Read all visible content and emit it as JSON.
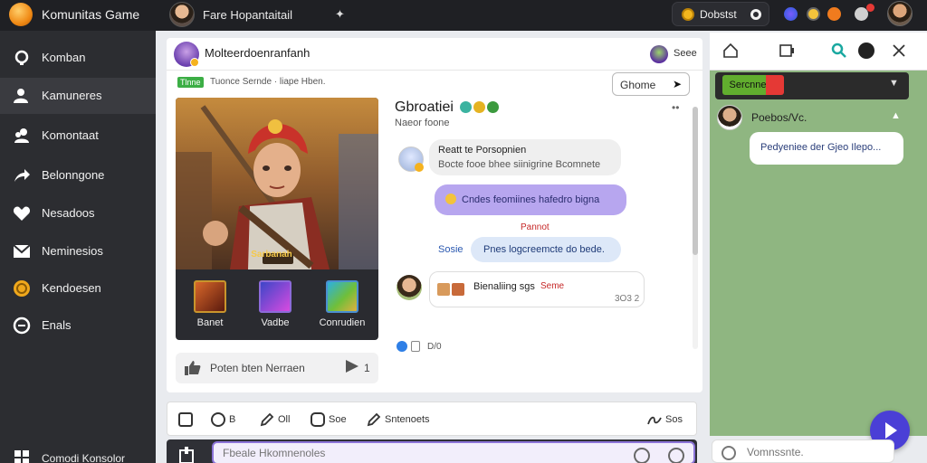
{
  "app": {
    "title": "Komunitas Game"
  },
  "topbar": {
    "page_name": "Fare Hopantaitail",
    "action_icon": "pin-icon",
    "status_label": "Dobstst",
    "icons": [
      "globe-icon",
      "emoji-icon",
      "fire-icon",
      "bell-icon"
    ]
  },
  "sidebar": {
    "items": [
      {
        "label": "Komban",
        "icon": "search-icon"
      },
      {
        "label": "Kamuneres",
        "icon": "user-icon"
      },
      {
        "label": "Komontaat",
        "icon": "users-icon"
      },
      {
        "label": "Belonngone",
        "icon": "share-icon"
      },
      {
        "label": "Nesadoos",
        "icon": "heart-icon"
      },
      {
        "label": "Neminesios",
        "icon": "mail-icon"
      },
      {
        "label": "Kendoesen",
        "icon": "coin-icon"
      },
      {
        "label": "Enals",
        "icon": "plus-circle-icon"
      }
    ],
    "bottom_label": "Comodi Konsolor"
  },
  "post": {
    "title": "Molteerdoenranfanh",
    "header_right": "Seee",
    "tag": "Tlnne",
    "tag_text": "Tuonce Sernde · liape Hben.",
    "share_label": "Ghome",
    "art_label": "Sarbanah",
    "items": [
      {
        "label": "Banet",
        "icon": "sword-icon"
      },
      {
        "label": "Vadbe",
        "icon": "magic-icon"
      },
      {
        "label": "Conrudien",
        "icon": "bundle-icon"
      }
    ],
    "reaction_text": "Poten bten Nerraen",
    "reaction_count": "1",
    "profile_name": "Gbroatiei",
    "profile_sub": "Naeor foone",
    "messages": [
      {
        "title": "Reatt te Porsopnien",
        "text": "Bocte fooe bhee siinigrine Bcomnete"
      },
      {
        "text": "Cndes feomiines hafedro bigna"
      },
      {
        "text": "Pannot"
      },
      {
        "side_label": "Sosie",
        "text": "Pnes logcreemcte do bede."
      },
      {
        "text": "Bienaliing sgs",
        "highlight": "Seme",
        "meta": "3O3 2"
      }
    ],
    "likes": "D/0"
  },
  "actions": [
    {
      "label": "",
      "icon": "square-icon"
    },
    {
      "label": "B",
      "icon": "comment-icon"
    },
    {
      "label": "Oll",
      "icon": "pencil-icon"
    },
    {
      "label": "Soe",
      "icon": "chat-icon"
    },
    {
      "label": "Sntenoets",
      "icon": "edit-icon"
    },
    {
      "label": "Sos",
      "icon": "signature-icon"
    }
  ],
  "composer": {
    "placeholder": "Fbeale Hkomnenoles"
  },
  "right_panel": {
    "header_button": "Sercnne",
    "author": "Poebos/Vc.",
    "bubble": "Pedyeniee der Gjeo Ilepo...",
    "input_placeholder": "Vomnssnte."
  }
}
